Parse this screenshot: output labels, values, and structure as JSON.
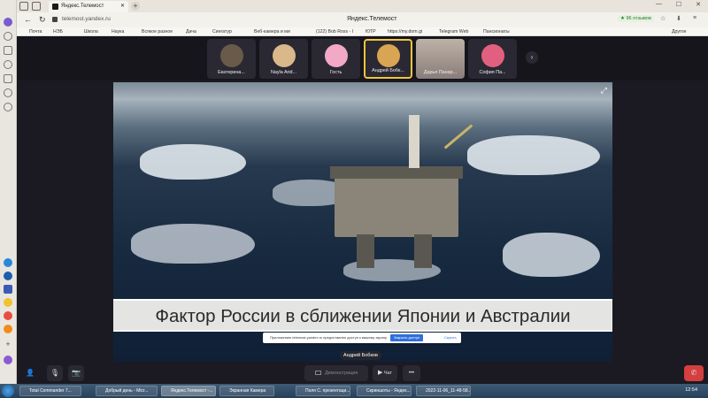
{
  "browser": {
    "tab_title": "Яндекс.Телемост",
    "window_title": "Яндекс.Телемост",
    "url": "telemost.yandex.ru",
    "reviews": "★ 96 отзывов",
    "bookmarks": [
      "Почта",
      "НЭБ",
      "Школа",
      "Наука",
      "Всякое разное",
      "Дача",
      "Сингатур",
      "Веб-камера и ми",
      "(122) Bob Ross - I",
      "ЮТР",
      "https://my.dom.gi",
      "Telegram Web",
      "Пансионаты"
    ],
    "other_bookmarks": "Другое"
  },
  "participants": [
    {
      "name": "Екатерина...",
      "color": "#6a5a4a"
    },
    {
      "name": "Nayla Arid...",
      "color": "#d9b98a"
    },
    {
      "name": "Гость",
      "color": "#f2a9c6"
    },
    {
      "name": "Андрей Бобк...",
      "color": "#d9a552"
    },
    {
      "name": "Дарья Панар...",
      "color": "#8a7d7a"
    },
    {
      "name": "София Па...",
      "color": "#e2607f"
    }
  ],
  "slide": {
    "title": "Фактор России в сближении Японии и Австралии"
  },
  "speaker_label": "Андрей Бобков",
  "notice": {
    "text": "Приложению telemost.yandex.ru предоставлен доступ к вашему экрану.",
    "stop_label": "Закрыть доступ",
    "hide_label": "Скрыть"
  },
  "controls": {
    "demo_label": "Демонстрация",
    "chat_label": "Чат",
    "more_label": "•••"
  },
  "taskbar": {
    "items": [
      "Total Commander 7...",
      "Добрый день - Micr...",
      "Яндекс.Телемост -...",
      "Экранная Камера",
      "Поля С. презентаци...",
      "Скриншоты - Яндек...",
      "2022-11-06_11-48-58..."
    ],
    "clock": "12:54"
  }
}
